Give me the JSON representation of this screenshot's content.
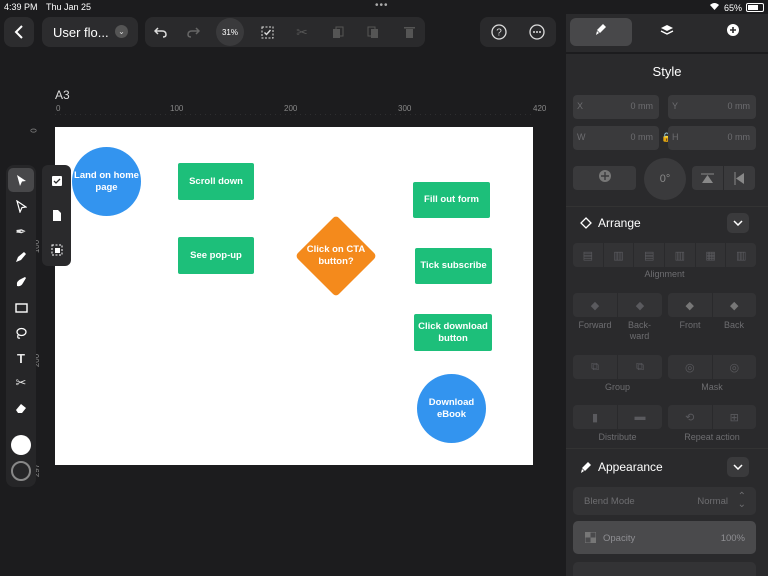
{
  "status": {
    "time": "4:39 PM",
    "date": "Thu Jan 25",
    "battery": "65%"
  },
  "toolbar": {
    "doc_title": "User flo...",
    "zoom": "31%",
    "icons": [
      "back-chevron-icon",
      "undo-icon",
      "redo-icon",
      "select-check-icon",
      "cut-icon",
      "copy-icon",
      "paste-icon",
      "trash-icon",
      "help-icon",
      "more-icon"
    ]
  },
  "panel_tabs": [
    "style-brush-icon",
    "layers-icon",
    "add-icon"
  ],
  "canvas": {
    "page_name": "A3",
    "ruler_x": [
      "0",
      "100",
      "200",
      "300",
      "420"
    ],
    "ruler_y": [
      "0",
      "100",
      "200",
      "297"
    ]
  },
  "flow": {
    "land": "Land on home page",
    "scroll": "Scroll down",
    "popup": "See pop-up",
    "cta": "Click on CTA button?",
    "form": "Fill out form",
    "tick": "Tick subscribe",
    "download_btn": "Click download button",
    "ebook": "Download eBook"
  },
  "colors": {
    "green": "#1dbf7a",
    "blue": "#3394ef",
    "orange": "#f48a1c",
    "bg": "#1c1c1e",
    "panel": "#2a2a2c"
  },
  "style_panel": {
    "title": "Style",
    "x": {
      "label": "X",
      "value": "0 mm"
    },
    "y": {
      "label": "Y",
      "value": "0 mm"
    },
    "w": {
      "label": "W",
      "value": "0 mm"
    },
    "h": {
      "label": "H",
      "value": "0 mm"
    },
    "rotation": "0°",
    "arrange": {
      "title": "Arrange",
      "alignment_label": "Alignment",
      "forward": "Forward",
      "backward": "Back-\nward",
      "front": "Front",
      "back": "Back",
      "group": "Group",
      "mask": "Mask",
      "distribute": "Distribute",
      "repeat": "Repeat action"
    },
    "appearance": {
      "title": "Appearance",
      "blend_label": "Blend Mode",
      "blend_value": "Normal",
      "opacity_label": "Opacity",
      "opacity_value": "100%"
    }
  }
}
